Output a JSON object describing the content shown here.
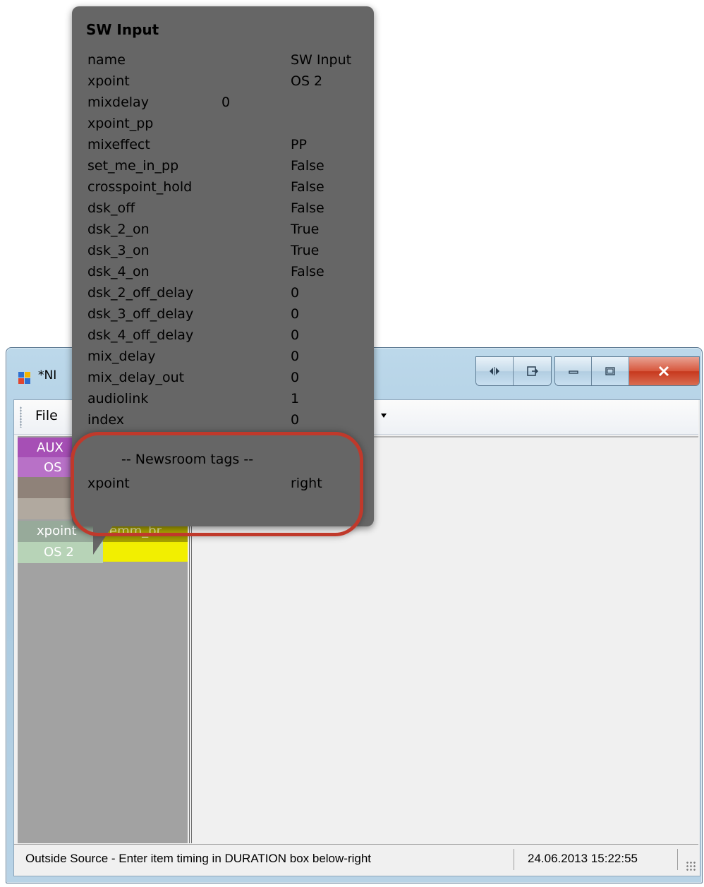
{
  "window": {
    "title": "*NI",
    "menu": {
      "file_label": "File"
    }
  },
  "left_panel": {
    "rows": [
      {
        "label": "AUX",
        "color": "#a64fb5"
      },
      {
        "label": "OS",
        "color": "#b871c7"
      },
      {
        "label": "",
        "color": "#8f8279"
      },
      {
        "label": "",
        "color": "#b1a99f"
      },
      {
        "label": "xpoint",
        "color": "#97aa9a"
      },
      {
        "label": "OS 2",
        "color": "#b7d3b7"
      }
    ],
    "partial_label": "lemm_br",
    "accent_color": "#f2ef00"
  },
  "tooltip": {
    "title": "SW Input",
    "properties": [
      {
        "key": "name",
        "value": "SW Input"
      },
      {
        "key": "xpoint",
        "value": "OS 2"
      },
      {
        "key": "mixdelay",
        "value": "0"
      },
      {
        "key": "xpoint_pp",
        "value": ""
      },
      {
        "key": "mixeffect",
        "value": "PP"
      },
      {
        "key": "set_me_in_pp",
        "value": "False"
      },
      {
        "key": "crosspoint_hold",
        "value": "False"
      },
      {
        "key": "dsk_off",
        "value": "False"
      },
      {
        "key": "dsk_2_on",
        "value": "True"
      },
      {
        "key": "dsk_3_on",
        "value": "True"
      },
      {
        "key": "dsk_4_on",
        "value": "False"
      },
      {
        "key": "dsk_2_off_delay",
        "value": "0"
      },
      {
        "key": "dsk_3_off_delay",
        "value": "0"
      },
      {
        "key": "dsk_4_off_delay",
        "value": "0"
      },
      {
        "key": "mix_delay",
        "value": "0"
      },
      {
        "key": "mix_delay_out",
        "value": "0"
      },
      {
        "key": "audiolink",
        "value": "1"
      },
      {
        "key": "index",
        "value": "0"
      }
    ],
    "newsroom_header": "-- Newsroom tags --",
    "newsroom_tags": [
      {
        "key": "xpoint",
        "value": "right"
      }
    ],
    "highlight_color": "#c0392b"
  },
  "statusbar": {
    "message": "Outside Source - Enter item timing in DURATION box below-right",
    "datetime": "24.06.2013 15:22:55"
  },
  "icons": {
    "app": "app-icon",
    "caption": [
      "split-view-icon",
      "popout-icon",
      "minimize-icon",
      "maximize-icon",
      "close-icon"
    ]
  }
}
